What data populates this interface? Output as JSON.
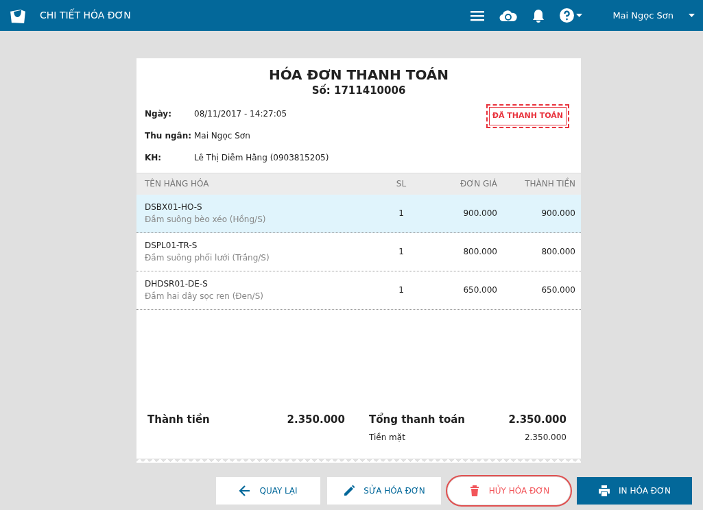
{
  "header": {
    "title": "CHI TIẾT HÓA ĐƠN",
    "user": "Mai Ngọc Sơn"
  },
  "invoice": {
    "title": "HÓA ĐƠN THANH TOÁN",
    "number": "Số: 1711410006",
    "stamp": "ĐÃ THANH TOÁN",
    "info": [
      {
        "label": "Ngày:",
        "value": "08/11/2017 - 14:27:05"
      },
      {
        "label": "Thu ngân:",
        "value": "Mai Ngọc Sơn"
      },
      {
        "label": "KH:",
        "value": "Lê Thị Diễm Hằng (0903815205)"
      }
    ],
    "table": {
      "columns": [
        "TÊN HÀNG HÓA",
        "SL",
        "ĐƠN GIÁ",
        "THÀNH TIỀN"
      ],
      "rows": [
        {
          "code": "DSBX01-HO-S",
          "name": "Đầm suông bèo xéo (Hồng/S)",
          "qty": "1",
          "price": "900.000",
          "total": "900.000",
          "selected": true
        },
        {
          "code": "DSPL01-TR-S",
          "name": "Đầm suông phối lưới (Trắng/S)",
          "qty": "1",
          "price": "800.000",
          "total": "800.000",
          "selected": false
        },
        {
          "code": "DHDSR01-DE-S",
          "name": "Đầm hai dây sọc ren (Đen/S)",
          "qty": "1",
          "price": "650.000",
          "total": "650.000",
          "selected": false
        }
      ]
    },
    "subtotal": {
      "label": "Thành tiền",
      "value": "2.350.000"
    },
    "grand_total": {
      "label": "Tổng thanh toán",
      "value": "2.350.000"
    },
    "payment": {
      "label": "Tiền mặt",
      "value": "2.350.000"
    }
  },
  "buttons": [
    {
      "kind": "back",
      "label": "QUAY LẠI",
      "highlighted": false
    },
    {
      "kind": "edit",
      "label": "SỬA HÓA ĐƠN",
      "highlighted": false
    },
    {
      "kind": "cancel",
      "label": "HỦY HÓA ĐƠN",
      "highlighted": true
    },
    {
      "kind": "print",
      "label": "IN HÓA ĐƠN",
      "highlighted": false
    }
  ]
}
